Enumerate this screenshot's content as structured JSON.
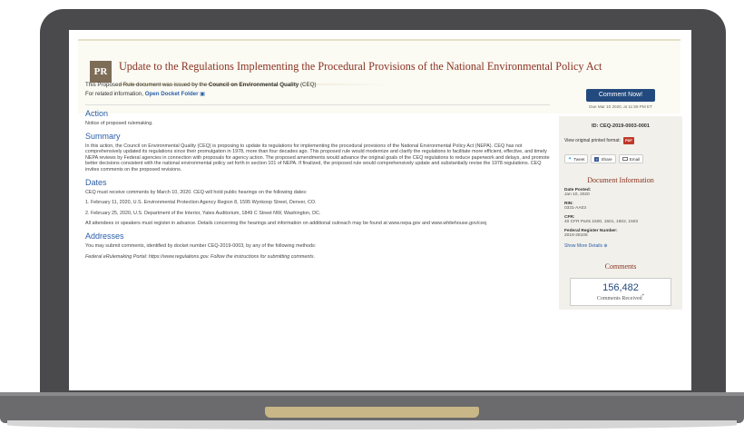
{
  "document": {
    "badge": "PR",
    "title": "Update to the Regulations Implementing the Procedural Provisions of the National Environmental Policy Act",
    "intro_text_1": "This Proposed Rule document was issued by the ",
    "intro_agency": "Council on Environmental Quality",
    "intro_text_2": " (CEQ)",
    "related_text": "For related information, ",
    "docket_link": "Open Docket Folder"
  },
  "sections": {
    "action_heading": "Action",
    "action_text": "Notice of proposed rulemaking.",
    "summary_heading": "Summary",
    "summary_text": "In this action, the Council on Environmental Quality (CEQ) is proposing to update its regulations for implementing the procedural provisions of the National Environmental Policy Act (NEPA). CEQ has not comprehensively updated its regulations since their promulgation in 1978, more than four decades ago. This proposed rule would modernize and clarify the regulations to facilitate more efficient, effective, and timely NEPA reviews by Federal agencies in connection with proposals for agency action. The proposed amendments would advance the original goals of the CEQ regulations to reduce paperwork and delays, and promote better decisions consistent with the national environmental policy set forth in section 101 of NEPA. If finalized, the proposed rule would comprehensively update and substantially revise the 1978 regulations. CEQ invites comments on the proposed revisions.",
    "dates_heading": "Dates",
    "dates_text": "CEQ must receive comments by March 10, 2020. CEQ will hold public hearings on the following dates:",
    "hearing_1": "1. February 11, 2020, U.S. Environmental Protection Agency Region 8, 1595 Wynkoop Street, Denver, CO.",
    "hearing_2": "2. February 25, 2020, U.S. Department of the Interior, Yates Auditorium, 1849 C Street NW, Washington, DC.",
    "attendees_text": "All attendees or speakers must register in advance. Details concerning the hearings and information on additional outreach may be found at www.nepa.gov and www.whitehouse.gov/ceq",
    "addresses_heading": "Addresses",
    "addresses_text": "You may submit comments, identified by docket number CEQ-2019-0003, by any of the following methods:",
    "portal_text": "Federal eRulemaking Portal: https://www.regulations.gov. Follow the instructions for submitting comments."
  },
  "sidebar": {
    "comment_button": "Comment Now!",
    "due": "Due Mar 10 2020, at 11:59 PM ET",
    "id_line": "ID: CEQ-2019-0003-0001",
    "original_format": "View original printed format:",
    "pdf_label": "PDF",
    "share_tweet": "Tweet",
    "share_facebook": "Share",
    "share_email": "Email",
    "doc_info_heading": "Document Information",
    "date_posted_label": "Date Posted:",
    "date_posted": "Jan 10, 2020",
    "rin_label": "RIN:",
    "rin": "0331-AA03",
    "cfr_label": "CFR:",
    "cfr": "40 CFR Parts 1500, 1501, 1502, 1503",
    "fr_number_label": "Federal Register Number:",
    "fr_number": "2019-28106",
    "show_more": "Show More Details",
    "comments_heading": "Comments",
    "comments_count": "156,482",
    "comments_label": "Comments Received"
  }
}
